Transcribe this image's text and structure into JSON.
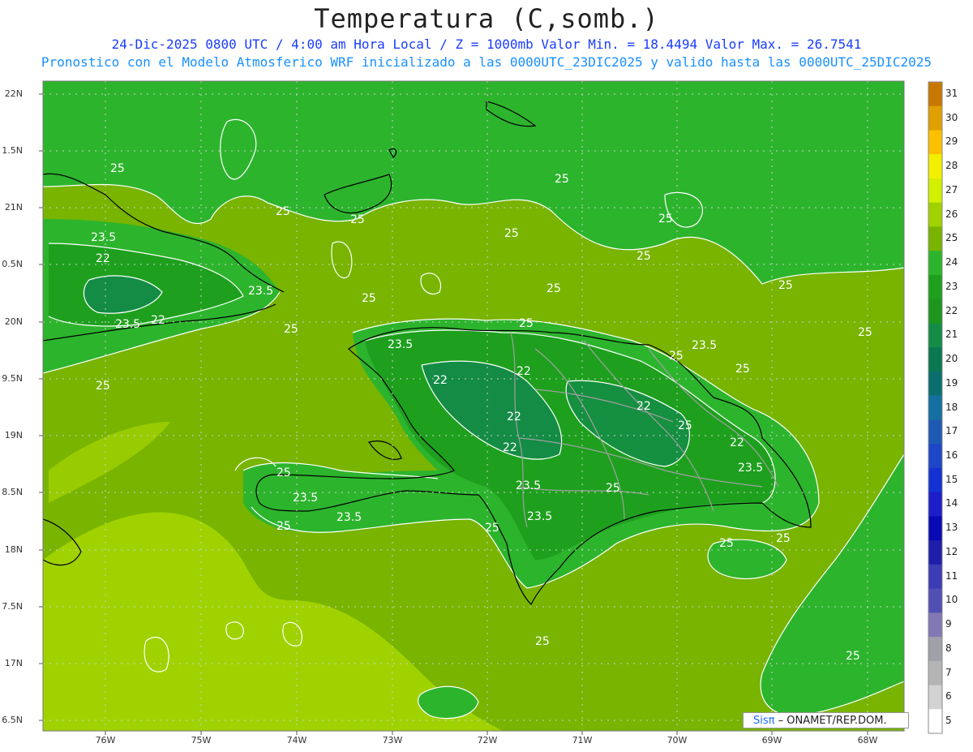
{
  "title": "Temperatura (C,somb.)",
  "subtitle_line1": "24-Dic-2025  0800 UTC / 4:00 am Hora Local / Z = 1000mb   Valor Min. = 18.4494  Valor Max. = 26.7541",
  "subtitle_line2": "Pronostico con el Modelo Atmosferico WRF inicializado a las 0000UTC_23DIC2025 y valido hasta las  0000UTC_25DIC2025",
  "lat_labels": [
    "22N",
    "1.5N",
    "21N",
    "0.5N",
    "20N",
    "9.5N",
    "19N",
    "8.5N",
    "18N",
    "7.5N",
    "17N",
    "6.5N"
  ],
  "lon_labels": [
    "76W",
    "75W",
    "74W",
    "73W",
    "72W",
    "71W",
    "70W",
    "69W",
    "68W"
  ],
  "colorbar": {
    "labels": [
      "31",
      "30",
      "29",
      "28",
      "27",
      "26",
      "25",
      "24",
      "23",
      "22",
      "21",
      "20",
      "19",
      "18",
      "17",
      "16",
      "15",
      "14",
      "13",
      "12",
      "11",
      "10",
      "9",
      "8",
      "7",
      "6",
      "5"
    ],
    "colors": [
      "#c87800",
      "#e0a000",
      "#ffc000",
      "#f0f000",
      "#d2f000",
      "#a0d200",
      "#78b400",
      "#2db42d",
      "#1ea01e",
      "#1e961e",
      "#148c46",
      "#0a7850",
      "#0a6e6e",
      "#1470a0",
      "#1e5ab4",
      "#1e46c8",
      "#1432d2",
      "#1e1ec8",
      "#0a0ab4",
      "#1e1eaa",
      "#3c3cb4",
      "#5050b4",
      "#8278b4",
      "#a0a0aa",
      "#b4b4b4",
      "#d2d2d2",
      "#ffffff"
    ]
  },
  "contour_labels": [
    "25",
    "25",
    "25",
    "25",
    "25",
    "23.5",
    "22",
    "25",
    "25",
    "23.5",
    "22",
    "23.5",
    "25",
    "25",
    "25",
    "25",
    "25",
    "25",
    "23.5",
    "22",
    "22",
    "22",
    "25",
    "22",
    "22",
    "22",
    "23.5",
    "23.5",
    "25",
    "23.5",
    "25",
    "23.5",
    "23.5",
    "25",
    "23.5",
    "25",
    "25",
    "25",
    "25",
    "25",
    "25",
    "25",
    "25"
  ],
  "credit": {
    "sis": "Sisπ",
    "rest": "– ONAMET/REP.DOM."
  }
}
